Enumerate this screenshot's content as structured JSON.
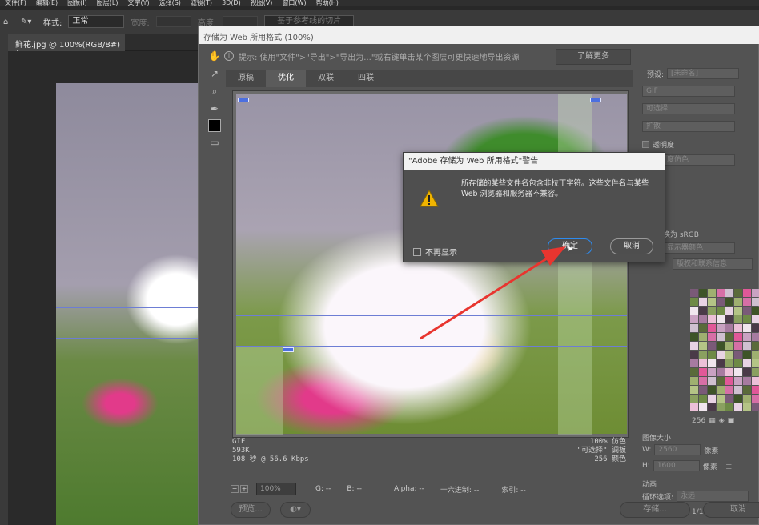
{
  "menubar": {
    "items": [
      "文件(F)",
      "编辑(E)",
      "图像(I)",
      "图层(L)",
      "文字(Y)",
      "选择(S)",
      "滤镜(T)",
      "3D(D)",
      "视图(V)",
      "窗口(W)",
      "帮助(H)"
    ]
  },
  "options": {
    "style_label": "样式:",
    "style_value": "正常",
    "width_label": "宽度:",
    "height_label": "高度:",
    "slices_button": "基于参考线的切片"
  },
  "document": {
    "tab_title": "鲜花.jpg @ 100%(RGB/8#) *",
    "close_glyph": "×"
  },
  "dialog": {
    "title": "存储为 Web 所用格式 (100%)",
    "hint": "提示: 使用\"文件\">\"导出\">\"导出为...\"或右键单击某个图层可更快速地导出资源",
    "learn_more": "了解更多",
    "tabs": [
      "原稿",
      "优化",
      "双联",
      "四联"
    ],
    "active_tab": "优化",
    "preview_info_left": [
      "GIF",
      "593K",
      "108 秒 @ 56.6 Kbps"
    ],
    "preview_info_right": [
      "100% 仿色",
      "\"可选择\" 调板",
      "256 颜色"
    ],
    "zoom": "100%",
    "status": {
      "g": "G: --",
      "b": "B: --",
      "alpha": "Alpha: --",
      "hex": "十六进制: --",
      "index": "索引: --"
    },
    "buttons": {
      "preview": "预览...",
      "save": "存储...",
      "cancel": "取消"
    },
    "right_panel": {
      "preset_label": "预设:",
      "preset_value": "[未命名]",
      "format": "GIF",
      "reduction": "可选择",
      "dither": "扩散",
      "transparency": "透明度",
      "matte_label": "度仿色",
      "srgb": "换为 sRGB",
      "preview_color": "显示器颜色",
      "metadata": "版权和联系信息",
      "color_count": "256",
      "image_size_title": "图像大小",
      "w_label": "W:",
      "w_value": "2560",
      "h_label": "H:",
      "h_value": "1600",
      "unit": "像素",
      "animation_title": "动画",
      "loop_label": "循环选项:",
      "loop_value": "永远",
      "frame": "1/1"
    }
  },
  "alert": {
    "title": "\"Adobe 存储为 Web 所用格式\"警告",
    "message": "所存储的某些文件名包含非拉丁字符。这些文件名与某些 Web 浏览器和服务器不兼容。",
    "dont_show": "不再显示",
    "ok": "确定",
    "cancel": "取消"
  },
  "colors": {
    "accent": "#2d8bef",
    "arrow": "#e8352f",
    "warning": "#f0b400"
  }
}
